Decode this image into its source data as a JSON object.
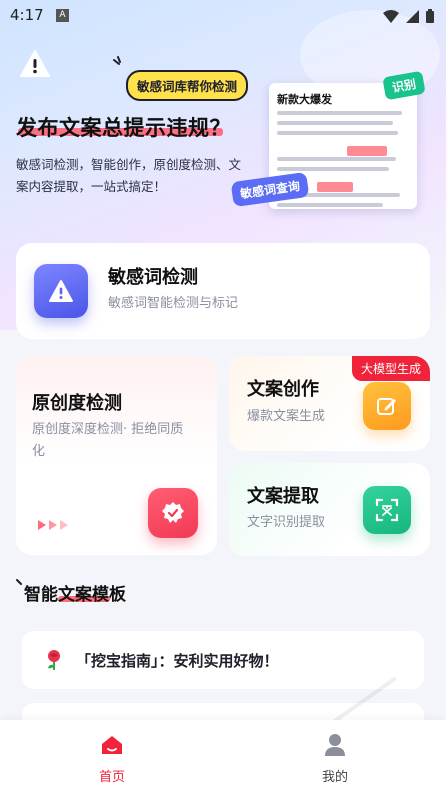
{
  "status_bar": {
    "time": "4:17",
    "app_badge": "A"
  },
  "hero": {
    "bubble": "敏感词库帮你检测",
    "title": "发布文案总提示违规？",
    "description": "敏感词检测，智能创作，原创度检测、文案内容提取，一站式搞定！",
    "doc_title": "新款大爆发",
    "tag_identify": "识别",
    "tag_query": "敏感词查询"
  },
  "cards": {
    "sensitive": {
      "title": "敏感词检测",
      "subtitle": "敏感词智能检测与标记"
    },
    "original": {
      "title": "原创度检测",
      "subtitle": "原创度深度检测· 拒绝同质化"
    },
    "create": {
      "title": "文案创作",
      "subtitle": "爆款文案生成",
      "badge": "大模型生成"
    },
    "extract": {
      "title": "文案提取",
      "subtitle": "文字识别提取"
    }
  },
  "section": {
    "title": "智能文案模板"
  },
  "templates": [
    {
      "text": "「挖宝指南」：安利实用好物！"
    }
  ],
  "bottom_nav": [
    {
      "label": "首页"
    },
    {
      "label": "我的"
    }
  ],
  "colors": {
    "accent_red": "#f0233b",
    "purple": "#5b6cf5",
    "green": "#19c38c",
    "orange": "#ff9a1e",
    "yellow": "#ffe14b"
  }
}
